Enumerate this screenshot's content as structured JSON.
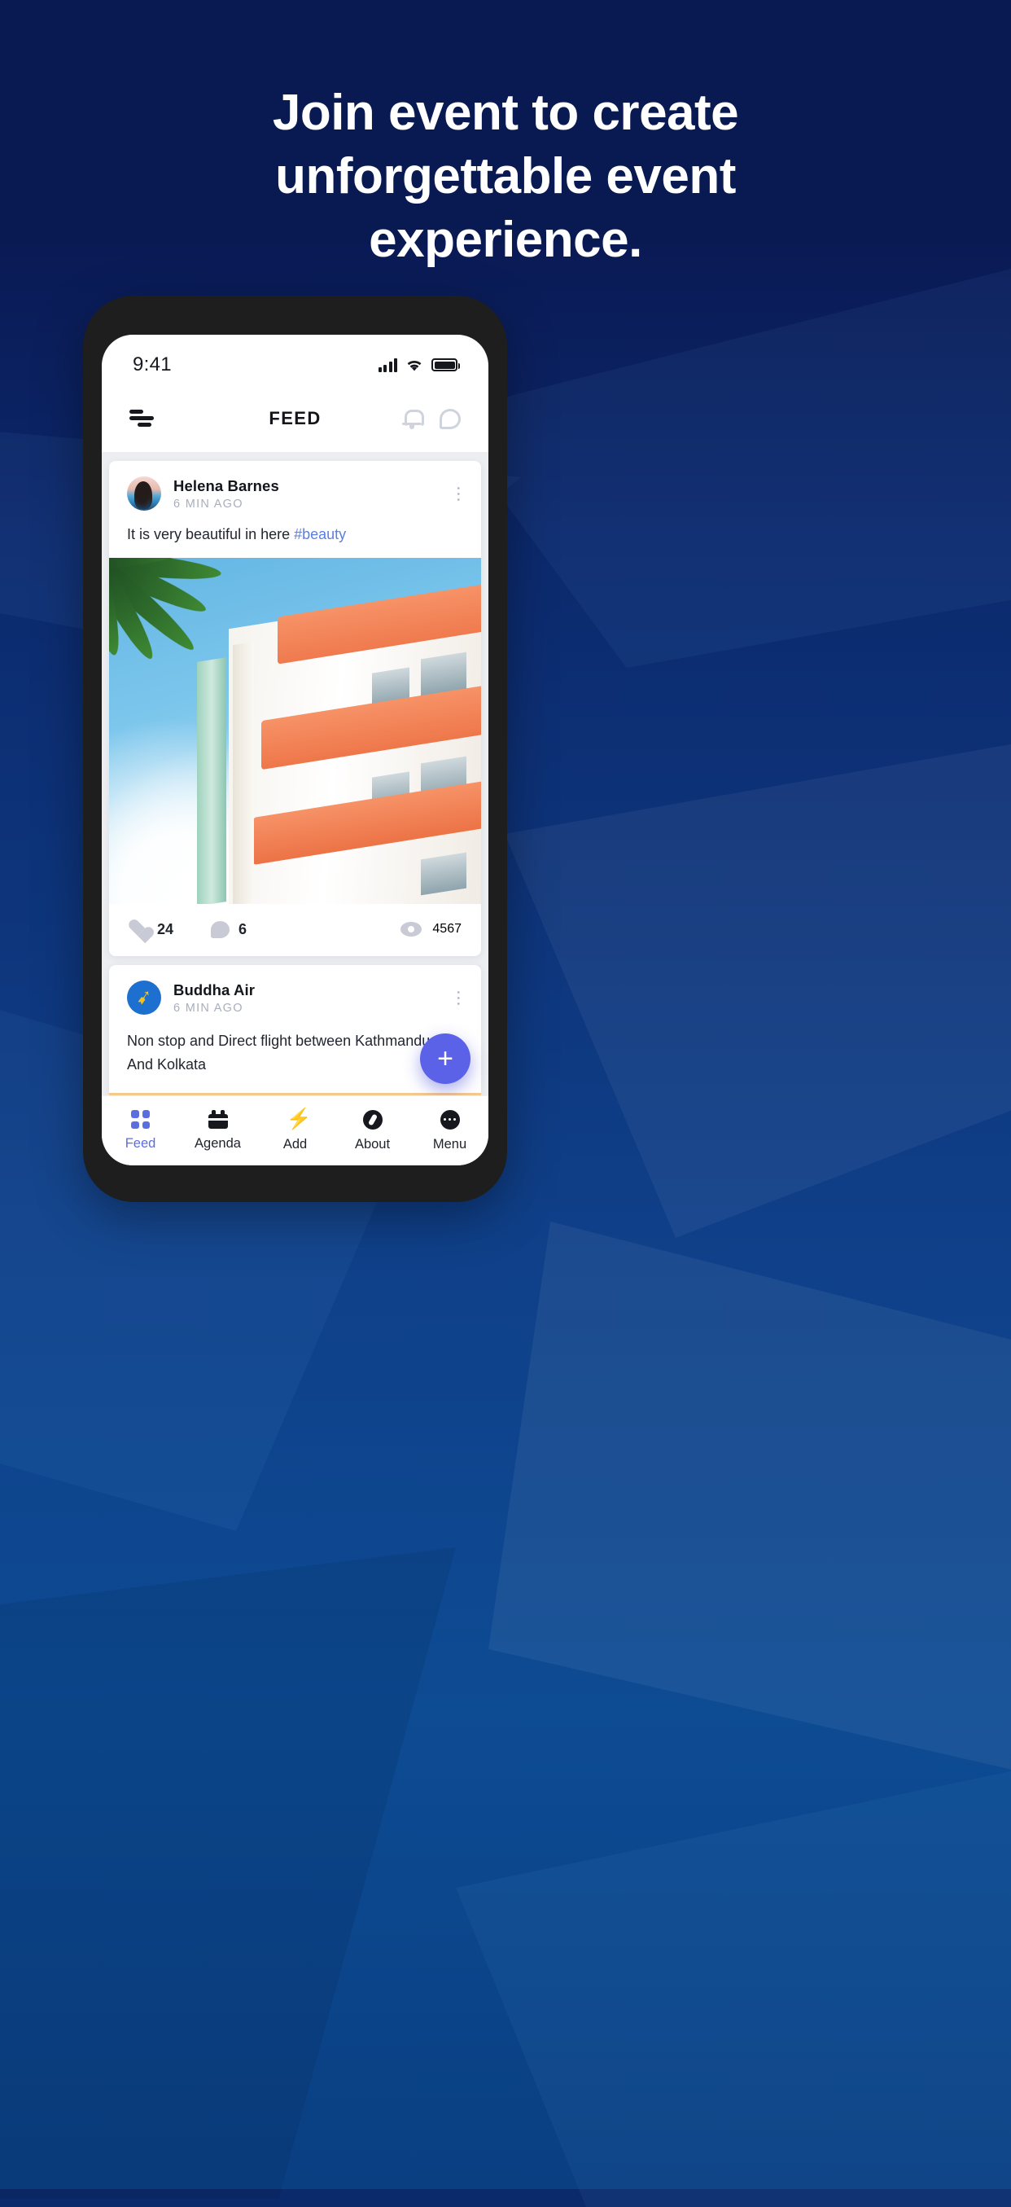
{
  "headline": {
    "line1": "Join event to create",
    "line2": "unforgettable event",
    "line3": "experience."
  },
  "phone": {
    "status_bar": {
      "time": "9:41",
      "signal_icon": "cellular-signal-icon",
      "wifi_icon": "wifi-icon",
      "battery_icon": "battery-full-icon"
    },
    "app_bar": {
      "filter_icon": "filter-icon",
      "title": "FEED",
      "bell_icon": "bell-icon",
      "chat_icon": "chat-icon"
    },
    "posts": [
      {
        "author": "Helena Barnes",
        "timestamp": "6 MIN AGO",
        "menu_icon": "more-vertical-icon",
        "text": "It is very beautiful in here ",
        "hashtag": "#beauty",
        "likes": "24",
        "comments": "6",
        "views": "4567",
        "like_icon": "heart-icon",
        "comment_icon": "comment-bubble-icon",
        "view_icon": "eye-icon"
      },
      {
        "author": "Buddha Air",
        "timestamp": "6 MIN AGO",
        "menu_icon": "more-vertical-icon",
        "text_line1": "Non stop and Direct flight between Kathmandu",
        "text_line2": "And Kolkata"
      }
    ],
    "fab": {
      "label": "+",
      "icon": "plus-icon",
      "color": "#5b62e8"
    },
    "bottom_nav": [
      {
        "label": "Feed",
        "icon": "grid-icon",
        "active": true
      },
      {
        "label": "Agenda",
        "icon": "calendar-icon",
        "active": false
      },
      {
        "label": "Add",
        "icon": "bolt-icon",
        "active": false
      },
      {
        "label": "About",
        "icon": "compass-icon",
        "active": false
      },
      {
        "label": "Menu",
        "icon": "dots-icon",
        "active": false
      }
    ]
  },
  "colors": {
    "background_top": "#0a1a55",
    "background_bottom": "#0d4b93",
    "accent": "#5b6ee0",
    "hashtag": "#5a7fe0"
  }
}
